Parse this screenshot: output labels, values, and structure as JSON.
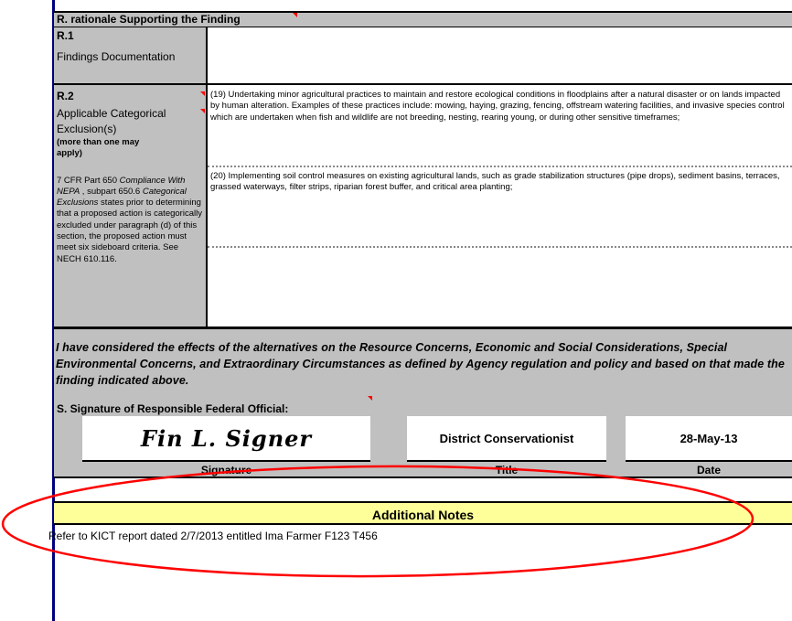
{
  "section_r": {
    "title": "R.  rationale Supporting the Finding",
    "r1": {
      "id": "R.1",
      "label": "Findings Documentation"
    },
    "r2": {
      "id": "R.2",
      "label": "Applicable Categorical Exclusion(s)",
      "note": "(more than one may apply)",
      "cfr_a": "7 CFR Part 650 ",
      "cfr_b": "Compliance With NEPA",
      "cfr_c": "  , subpart 650.6 ",
      "cfr_d": "Categorical Exclusions",
      "cfr_e": "    states prior to determining that a proposed action is categorically excluded under paragraph (d) of this section, the proposed action must meet six sideboard criteria. See NECH 610.116.",
      "exclusion_19": "(19) Undertaking minor agricultural practices to maintain and restore ecological conditions in floodplains after a natural disaster or on lands impacted by human alteration. Examples of these practices include: mowing, haying, grazing, fencing, offstream watering facilities, and invasive species control which are undertaken when fish and wildlife are not breeding, nesting, rearing young, or during other sensitive timeframes;",
      "exclusion_20": "(20) Implementing soil control measures on existing agricultural lands, such as grade stabilization structures (pipe drops), sediment basins, terraces, grassed waterways, filter strips, riparian forest buffer, and critical area planting;"
    }
  },
  "statement": "I have considered the effects of the alternatives on the Resource Concerns, Economic and Social Considerations, Special Environmental Concerns, and Extraordinary Circumstances as defined by Agency regulation and policy and based on that made the finding indicated above.",
  "section_s": {
    "title": "S.  Signature of Responsible Federal Official:",
    "signature_value": "Fin L. Signer",
    "title_value": "District Conservationist",
    "date_value": "28-May-13",
    "signature_label": "Signature",
    "title_label": "Title",
    "date_label": "Date"
  },
  "notes": {
    "header": "Additional Notes",
    "text": "Refer to KICT report dated 2/7/2013 entitled Ima Farmer F123 T456"
  },
  "colors": {
    "cell_gray": "#c0c0c0",
    "notes_yellow": "#ffff99",
    "annotation_red": "#ff0000",
    "left_border_blue": "#00007f"
  }
}
